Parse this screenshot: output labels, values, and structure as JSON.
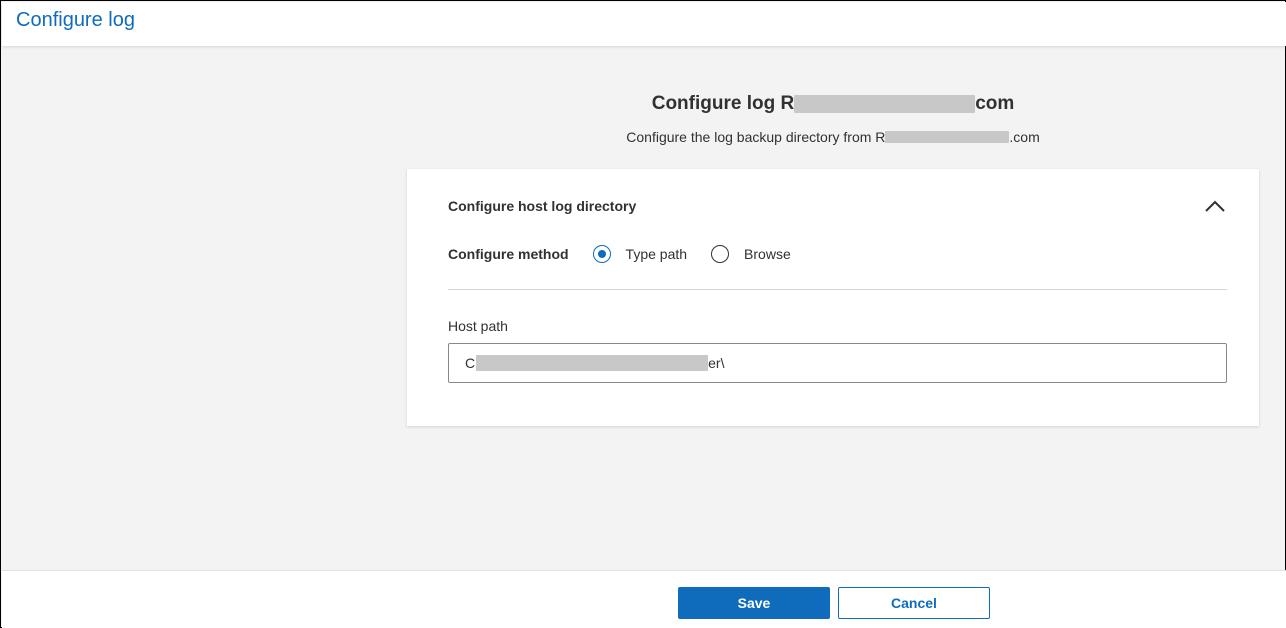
{
  "header": {
    "title": "Configure log"
  },
  "page": {
    "heading_prefix": "Configure log R",
    "heading_suffix": "com",
    "subtitle_prefix": "Configure the log backup directory from R",
    "subtitle_suffix": ".com"
  },
  "card": {
    "title": "Configure host log directory",
    "collapse_icon": "chevron-up-icon",
    "method_label": "Configure method",
    "options": [
      {
        "label": "Type path",
        "selected": true
      },
      {
        "label": "Browse",
        "selected": false
      }
    ],
    "host_path_label": "Host path",
    "host_path_prefix": "C",
    "host_path_suffix": "er\\"
  },
  "footer": {
    "save_label": "Save",
    "cancel_label": "Cancel"
  },
  "colors": {
    "accent": "#0f6cbd",
    "background": "#f3f3f3",
    "redaction": "#c8c8c8"
  }
}
